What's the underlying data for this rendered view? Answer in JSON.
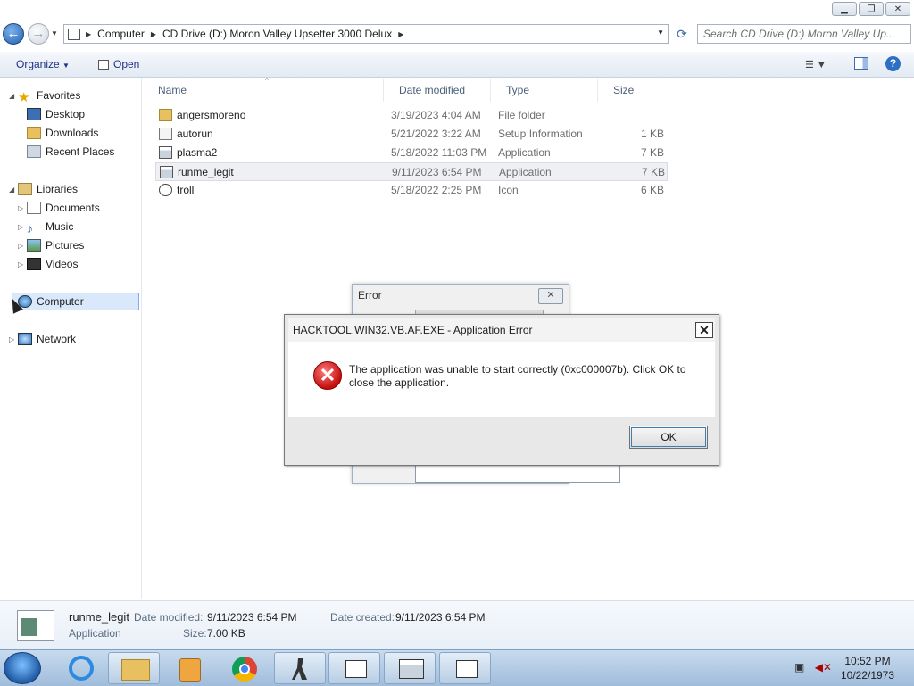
{
  "window": {
    "caption_buttons": [
      "minimize",
      "restore",
      "close"
    ]
  },
  "address_bar": {
    "crumbs": [
      "Computer",
      "CD Drive (D:) Moron Valley Upsetter 3000 Delux"
    ],
    "search_placeholder": "Search CD Drive (D:) Moron Valley Up..."
  },
  "toolbar": {
    "organize": "Organize",
    "open": "Open"
  },
  "navpane": {
    "favorites": "Favorites",
    "desktop": "Desktop",
    "downloads": "Downloads",
    "recent_places": "Recent Places",
    "libraries": "Libraries",
    "documents": "Documents",
    "music": "Music",
    "pictures": "Pictures",
    "videos": "Videos",
    "computer": "Computer",
    "network": "Network"
  },
  "columns": {
    "name": "Name",
    "date_modified": "Date modified",
    "type": "Type",
    "size": "Size"
  },
  "files": [
    {
      "name": "angersmoreno",
      "date": "3/19/2023 4:04 AM",
      "type": "File folder",
      "size": "",
      "icon": "folder-icon"
    },
    {
      "name": "autorun",
      "date": "5/21/2022 3:22 AM",
      "type": "Setup Information",
      "size": "1 KB",
      "icon": "settings-file-icon"
    },
    {
      "name": "plasma2",
      "date": "5/18/2022 11:03 PM",
      "type": "Application",
      "size": "7 KB",
      "icon": "application-icon"
    },
    {
      "name": "runme_legit",
      "date": "9/11/2023 6:54 PM",
      "type": "Application",
      "size": "7 KB",
      "icon": "application-icon",
      "selected": true
    },
    {
      "name": "troll",
      "date": "5/18/2022 2:25 PM",
      "type": "Icon",
      "size": "6 KB",
      "icon": "troll-face-icon"
    }
  ],
  "details": {
    "name": "runme_legit",
    "type": "Application",
    "date_modified_label": "Date modified:",
    "date_modified": "9/11/2023 6:54 PM",
    "date_created_label": "Date created:",
    "date_created": "9/11/2023 6:54 PM",
    "size_label": "Size:",
    "size": "7.00 KB"
  },
  "bg_dialog": {
    "title": "Error"
  },
  "error_dialog": {
    "title": "HACKTOOL.WIN32.VB.AF.EXE - Application Error",
    "message": "The application was unable to start correctly (0xc000007b). Click OK to close the application.",
    "ok": "OK"
  },
  "taskbar": {
    "apps": [
      "internet-explorer-icon",
      "file-explorer-icon",
      "media-player-icon",
      "chrome-icon",
      "counter-strike-icon",
      "folder-window-icon",
      "application-window-icon",
      "folder-window-icon"
    ],
    "time": "10:52 PM",
    "date": "10/22/1973"
  },
  "colors": {
    "selection": "#d9e8fa",
    "taskbar": "#b7cde4",
    "error_red": "#c40e0e"
  }
}
